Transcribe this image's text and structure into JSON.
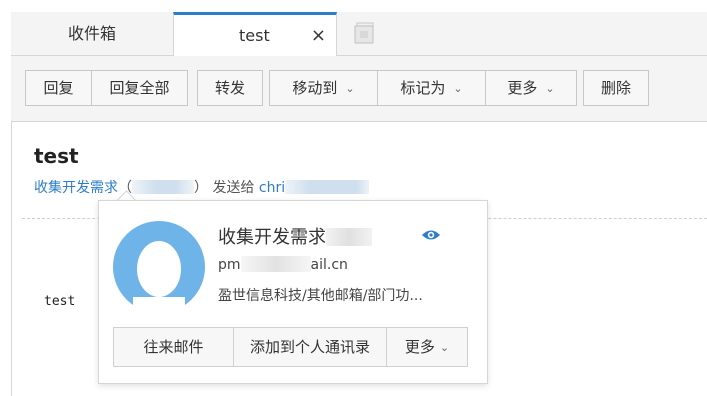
{
  "tabs": {
    "inbox_label": "收件箱",
    "test_label": "test",
    "close_glyph": "×"
  },
  "toolbar": {
    "reply": "回复",
    "reply_all": "回复全部",
    "forward": "转发",
    "move_to": "移动到",
    "mark_as": "标记为",
    "more": "更多",
    "delete": "删除",
    "chevron": "⌄"
  },
  "message": {
    "subject": "test",
    "from_name": "收集开发需求",
    "paren_open": "（",
    "paren_close": "）",
    "sent_to_label": "发送给",
    "to_name_prefix": "chri",
    "body": "test"
  },
  "contact_card": {
    "name": "收集开发需求",
    "email_prefix": "pm",
    "email_suffix": "ail.cn",
    "organization": "盈世信息科技/其他邮箱/部门功...",
    "buttons": {
      "mail_history": "往来邮件",
      "add_contact": "添加到个人通讯录",
      "more": "更多"
    }
  },
  "colors": {
    "accent": "#2d7ec9",
    "avatar": "#6fb4e8",
    "eye": "#2d7ec9"
  },
  "icons": {
    "new_tab": "new-tab-icon",
    "eye": "eye-icon",
    "avatar": "avatar-placeholder-icon"
  }
}
